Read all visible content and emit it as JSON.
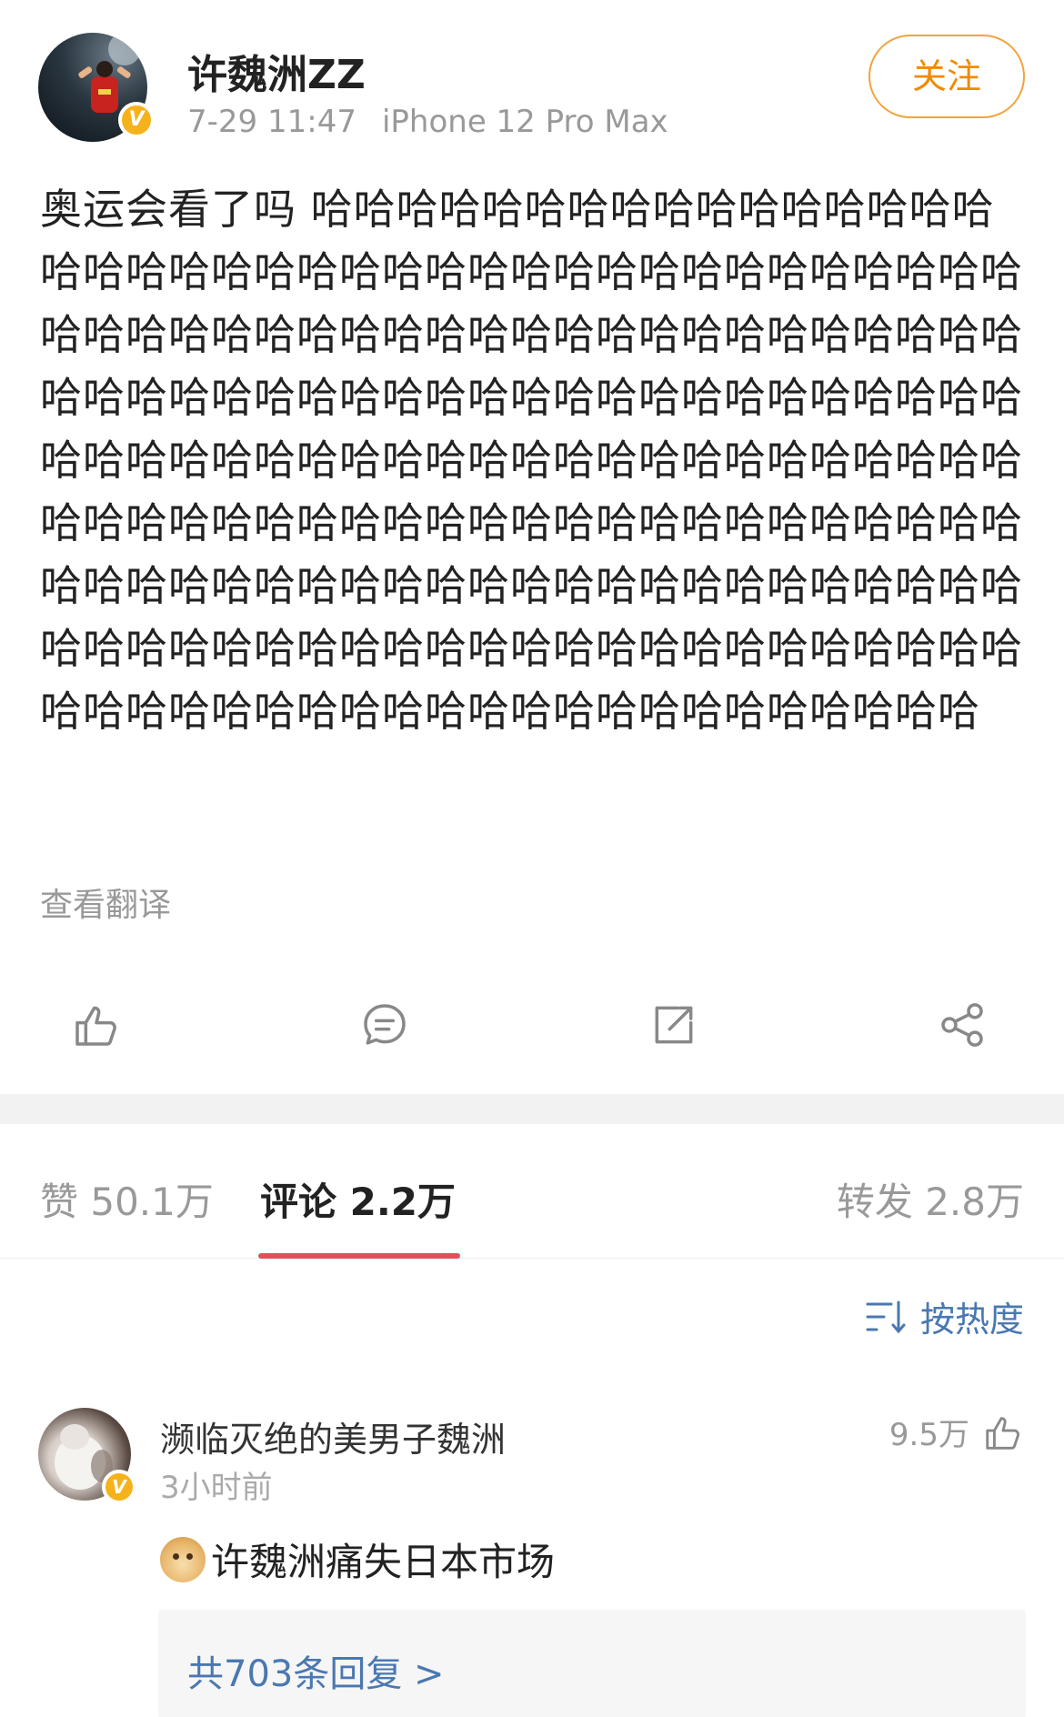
{
  "post": {
    "author": "许魏洲ZZ",
    "time": "7-29 11:47",
    "device": "iPhone 12 Pro Max",
    "follow_label": "关注",
    "verified_mark": "V",
    "text": "奥运会看了吗 哈哈哈哈哈哈哈哈哈哈哈哈哈哈哈哈哈哈哈哈哈哈哈哈哈哈哈哈哈哈哈哈哈哈哈哈哈哈哈哈哈哈哈哈哈哈哈哈哈哈哈哈哈哈哈哈哈哈哈哈哈哈哈哈哈哈哈哈哈哈哈哈哈哈哈哈哈哈哈哈哈哈哈哈哈哈哈哈哈哈哈哈哈哈哈哈哈哈哈哈哈哈哈哈哈哈哈哈哈哈哈哈哈哈哈哈哈哈哈哈哈哈哈哈哈哈哈哈哈哈哈哈哈哈哈哈哈哈哈哈哈哈哈哈哈哈哈哈哈哈哈哈哈哈哈哈哈哈哈哈哈哈哈哈哈哈哈哈哈哈哈哈哈哈哈哈哈哈哈哈哈哈哈哈哈哈哈哈哈哈哈哈哈哈哈哈哈哈哈",
    "translate_label": "查看翻译"
  },
  "actions": {
    "icons": [
      "like-icon",
      "comment-icon",
      "repost-icon",
      "share-icon"
    ]
  },
  "tabs": [
    {
      "label": "赞 50.1万",
      "active": false
    },
    {
      "label": "评论 2.2万",
      "active": true
    },
    {
      "label": "转发 2.8万",
      "active": false
    }
  ],
  "sort": {
    "label": "按热度",
    "icon": "sort-icon"
  },
  "comment": {
    "author": "濒临灭绝的美男子魏洲",
    "time": "3小时前",
    "likes": "9.5万",
    "verified_mark": "V",
    "emoji": "doge-emoji",
    "text": "许魏洲痛失日本市场",
    "replies_label": "共703条回复 >"
  },
  "colors": {
    "accent_orange": "#f08a00",
    "link_blue": "#4a78b0",
    "tab_indicator": "#e4505a",
    "verified": "#f6b21a"
  }
}
